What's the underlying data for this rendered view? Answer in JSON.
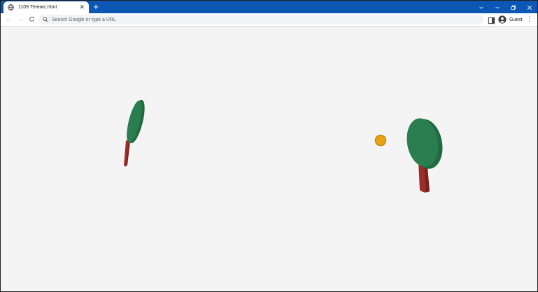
{
  "browser": {
    "tab": {
      "title": "1109 Теннис.html"
    },
    "new_tab_symbol": "+",
    "window_controls": {
      "tab_search": "⌵",
      "minimize": "—",
      "restore": "❐",
      "close": "✕"
    },
    "toolbar": {
      "back_symbol": "←",
      "forward_symbol": "→",
      "reload_symbol": "⟳",
      "omnibox_placeholder": "Search Google or type a URL",
      "profile_label": "Guest",
      "menu_symbol": "⋮"
    }
  },
  "scene": {
    "colors": {
      "background": "#f4f4f4",
      "paddle_face": "#2a7d4f",
      "paddle_face_dark": "#1f6a3f",
      "paddle_handle": "#9b2d2b",
      "paddle_handle_dark": "#7d1f1e",
      "ball": "#e8a317",
      "ball_outline": "#c8860a"
    },
    "objects": [
      "left-paddle",
      "right-paddle",
      "ball"
    ]
  }
}
